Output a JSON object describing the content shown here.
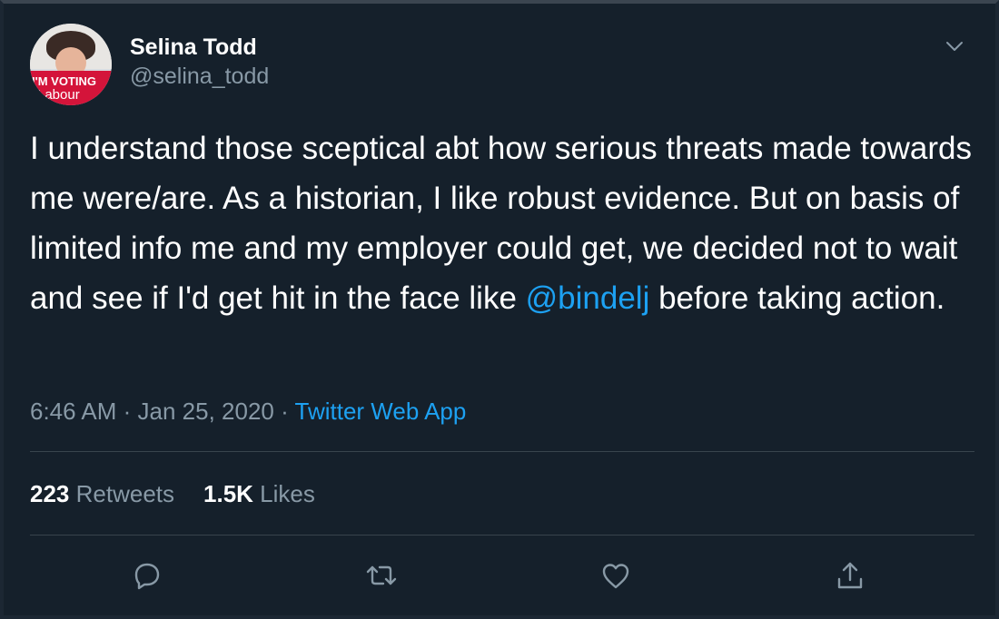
{
  "author": {
    "display_name": "Selina Todd",
    "handle": "@selina_todd",
    "avatar_sign_line1": "I'M VOTING",
    "avatar_sign_line2": "Labour"
  },
  "tweet": {
    "text_before": "I understand those sceptical abt how serious threats made towards me were/are. As a historian, I like robust evidence. But on basis of limited info me and my employer could get, we decided not to wait and see if I'd get hit in the face like ",
    "mention": "@bindelj",
    "text_after": " before taking action."
  },
  "meta": {
    "time": "6:46 AM",
    "separator1": " · ",
    "date": "Jan 25, 2020",
    "separator2": " · ",
    "source": "Twitter Web App"
  },
  "stats": {
    "retweets_count": "223",
    "retweets_label": "Retweets",
    "likes_count": "1.5K",
    "likes_label": "Likes"
  },
  "icons": {
    "menu": "chevron-down-icon",
    "reply": "reply-icon",
    "retweet": "retweet-icon",
    "like": "heart-icon",
    "share": "share-icon"
  },
  "colors": {
    "background": "#15202b",
    "accent": "#1da1f2",
    "secondary_text": "#8899a6",
    "divider": "#38444d"
  }
}
